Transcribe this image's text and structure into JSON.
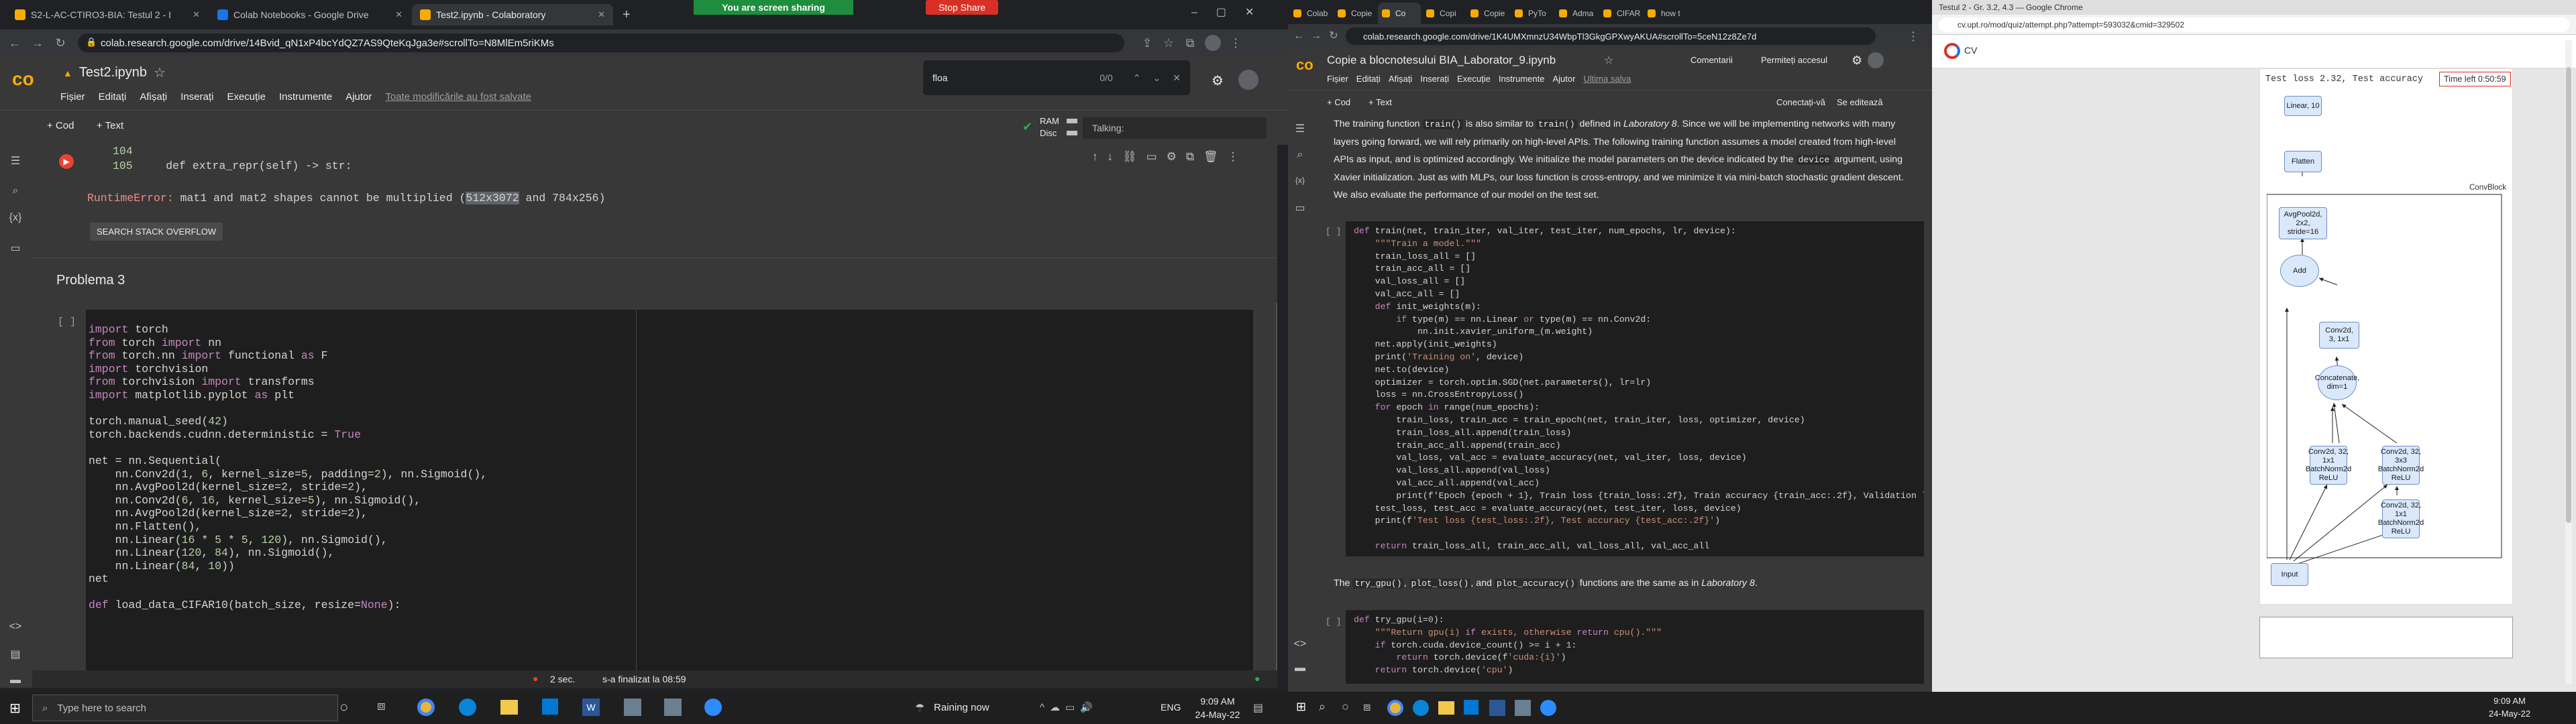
{
  "monitor1": {
    "tabs": [
      {
        "label": "S2-L-AC-CTIRO3-BIA: Testul 2 - I",
        "active": false,
        "color": "#f9ab00"
      },
      {
        "label": "Colab Notebooks - Google Drive",
        "active": false,
        "color": "#1a73e8"
      },
      {
        "label": "Test2.ipynb - Colaboratory",
        "active": true,
        "color": "#f9ab00"
      }
    ],
    "sharing_text": "You are screen sharing",
    "stop_share": "Stop Share",
    "url": "colab.research.google.com/drive/14Bvid_qN1xP4bcYdQZ7AS9QteKqJga3e#scrollTo=N8MlEm5riKMs",
    "notebook_title": "Test2.ipynb",
    "menu": [
      "Fișier",
      "Editați",
      "Afișați",
      "Inserați",
      "Execuție",
      "Instrumente",
      "Ajutor"
    ],
    "unsaved_msg": "Toate modificările au fost salvate",
    "find_query": "floa",
    "find_count": "0/0",
    "toolbar_cod": "+ Cod",
    "toolbar_text": "+ Text",
    "ram_label": "RAM",
    "disk_label": "Disc",
    "talking_label": "Talking:",
    "error_lines": [
      {
        "num": "104",
        "code": ""
      },
      {
        "num": "105",
        "code": "def extra_repr(self) -> str:"
      }
    ],
    "error_type": "RuntimeError:",
    "error_msg_a": "mat1 and mat2 shapes cannot be multiplied (",
    "error_msg_highlight": "512x3072",
    "error_msg_b": " and 784x256)",
    "so_button": "SEARCH STACK OVERFLOW",
    "section_title": "Problema 3",
    "cell_bracket": "[ ]",
    "code_lines": [
      "import torch",
      "from torch import nn",
      "from torch.nn import functional as F",
      "import torchvision",
      "from torchvision import transforms",
      "import matplotlib.pyplot as plt",
      "",
      "torch.manual_seed(42)",
      "torch.backends.cudnn.deterministic = True",
      "",
      "net = nn.Sequential(",
      "    nn.Conv2d(1, 6, kernel_size=5, padding=2), nn.Sigmoid(),",
      "    nn.AvgPool2d(kernel_size=2, stride=2),",
      "    nn.Conv2d(6, 16, kernel_size=5), nn.Sigmoid(),",
      "    nn.AvgPool2d(kernel_size=2, stride=2),",
      "    nn.Flatten(),",
      "    nn.Linear(16 * 5 * 5, 120), nn.Sigmoid(),",
      "    nn.Linear(120, 84), nn.Sigmoid(),",
      "    nn.Linear(84, 10))",
      "net",
      "",
      "def load_data_CIFAR10(batch_size, resize=None):"
    ],
    "status_time": "2 sec.",
    "status_done": "s-a finalizat la 08:59",
    "taskbar": {
      "search_placeholder": "Type here to search",
      "weather": "Raining now",
      "lang": "ENG",
      "time": "9:09 AM",
      "date": "24-May-22"
    }
  },
  "monitor2": {
    "tabs": [
      "Colab",
      "Copie",
      "Co",
      "Copi",
      "Copie",
      "PyTo",
      "Adma",
      "CIFAR",
      "how t"
    ],
    "url": "colab.research.google.com/drive/1K4UMXmnzU34WbpTl3GkgGPXwyAKUA#scrollTo=5ceN12z8Ze7d",
    "notebook_title": "Copie a blocnotesului BIA_Laborator_9.ipynb",
    "comments": "Comentarii",
    "share": "Permiteți accesul",
    "menu": [
      "Fișier",
      "Editați",
      "Afișați",
      "Inserați",
      "Execuție",
      "Instrumente",
      "Ajutor"
    ],
    "last_save": "Ultima salva",
    "toolbar_cod": "+ Cod",
    "toolbar_text": "+ Text",
    "connect": "Conectați-vă",
    "editing": "Se editează",
    "para1": [
      {
        "t": "The training function "
      },
      {
        "c": "train()"
      },
      {
        "t": " is also similar to "
      },
      {
        "c": "train()"
      },
      {
        "t": " defined in "
      },
      {
        "i": "Laboratory 8"
      },
      {
        "t": ". Since we will be implementing networks with many layers going forward, we will rely primarily on high-level APIs. The following training function assumes a model created from high-level APIs as input, and is optimized accordingly. We initialize the model parameters on the device indicated by the "
      },
      {
        "c": "device"
      },
      {
        "t": " argument, using Xavier initialization. Just as with MLPs, our loss function is cross-entropy, and we minimize it via mini-batch stochastic gradient descent. We also evaluate the performance of our model on the test set."
      }
    ],
    "cell1_bracket": "[ ]",
    "code1": [
      "def train(net, train_iter, val_iter, test_iter, num_epochs, lr, device):",
      "    \"\"\"Train a model.\"\"\"",
      "    train_loss_all = []",
      "    train_acc_all = []",
      "    val_loss_all = []",
      "    val_acc_all = []",
      "    def init_weights(m):",
      "        if type(m) == nn.Linear or type(m) == nn.Conv2d:",
      "            nn.init.xavier_uniform_(m.weight)",
      "    net.apply(init_weights)",
      "    print('Training on', device)",
      "    net.to(device)",
      "    optimizer = torch.optim.SGD(net.parameters(), lr=lr)",
      "    loss = nn.CrossEntropyLoss()",
      "    for epoch in range(num_epochs):",
      "        train_loss, train_acc = train_epoch(net, train_iter, loss, optimizer, device)",
      "        train_loss_all.append(train_loss)",
      "        train_acc_all.append(train_acc)",
      "        val_loss, val_acc = evaluate_accuracy(net, val_iter, loss, device)",
      "        val_loss_all.append(val_loss)",
      "        val_acc_all.append(val_acc)",
      "        print(f'Epoch {epoch + 1}, Train loss {train_loss:.2f}, Train accuracy {train_acc:.2f}, Validation l",
      "    test_loss, test_acc = evaluate_accuracy(net, test_iter, loss, device)",
      "    print(f'Test loss {test_loss:.2f}, Test accuracy {test_acc:.2f}')",
      "",
      "    return train_loss_all, train_acc_all, val_loss_all, val_acc_all"
    ],
    "para2": [
      {
        "t": "The "
      },
      {
        "c": "try_gpu()"
      },
      {
        "t": ", "
      },
      {
        "c": "plot_loss()"
      },
      {
        "t": ", and "
      },
      {
        "c": "plot_accuracy()"
      },
      {
        "t": " functions are the same as in "
      },
      {
        "i": "Laboratory 8"
      },
      {
        "t": "."
      }
    ],
    "cell2_bracket": "[ ]",
    "code2": [
      "def try_gpu(i=0):",
      "    \"\"\"Return gpu(i) if exists, otherwise return cpu().\"\"\"",
      "    if torch.cuda.device_count() >= i + 1:",
      "        return torch.device(f'cuda:{i}')",
      "    return torch.device('cpu')"
    ]
  },
  "monitor3": {
    "title": "Testul 2 - Gr. 3.2, 4.3 — Google Chrome",
    "url": "cv.upt.ro/mod/quiz/attempt.php?attempt=593032&cmid=329502",
    "brand": "CV",
    "code_caption": "Test loss 2.32, Test accuracy",
    "timer": "Time left 0:50:59",
    "convblock_label": "ConvBlock",
    "nodes": {
      "linear": "Linear, 10",
      "flatten": "Flatten",
      "avgpool": "AvgPool2d, 2x2, stride=16",
      "add": "Add",
      "conv1x1": "Conv2d, 3, 1x1",
      "concat": "Concatenate, dim=1",
      "convA": "Conv2d, 32, 1x1\nBatchNorm2d\nReLU",
      "convB": "Conv2d, 32, 3x3\nBatchNorm2d\nReLU",
      "convC": "Conv2d, 32, 1x1\nBatchNorm2d\nReLU",
      "input": "Input"
    },
    "taskbar": {
      "time": "9:09 AM",
      "date": "24-May-22"
    }
  }
}
